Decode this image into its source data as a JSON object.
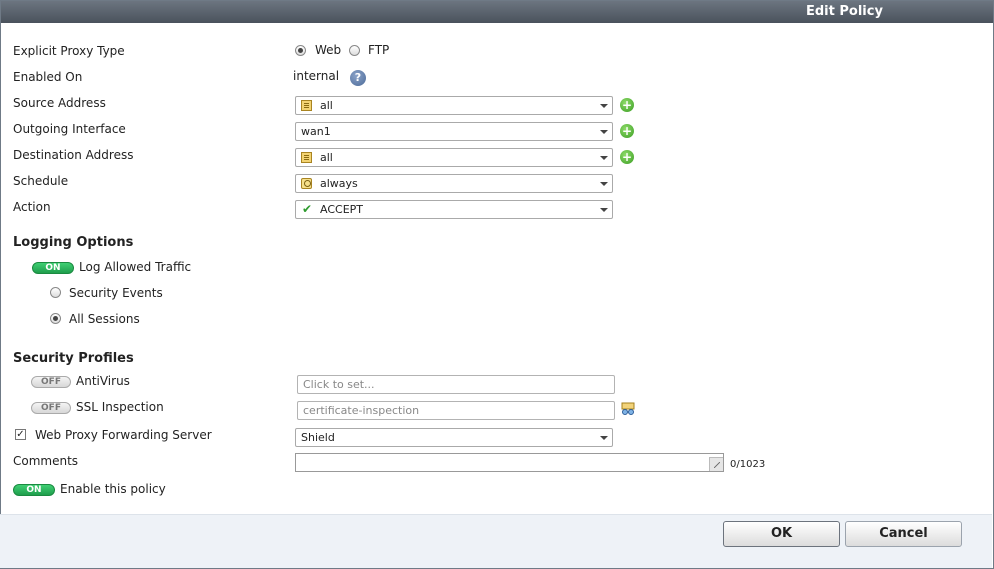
{
  "window": {
    "title": "Edit Policy"
  },
  "form": {
    "proxy_type": {
      "label": "Explicit Proxy Type",
      "options": [
        "Web",
        "FTP"
      ],
      "selected": "Web"
    },
    "enabled_on": {
      "label": "Enabled On",
      "value": "internal",
      "help_icon": "?"
    },
    "source_address": {
      "label": "Source Address",
      "value": "all"
    },
    "outgoing_interface": {
      "label": "Outgoing Interface",
      "value": "wan1"
    },
    "destination_address": {
      "label": "Destination Address",
      "value": "all"
    },
    "schedule": {
      "label": "Schedule",
      "value": "always"
    },
    "action": {
      "label": "Action",
      "value": "ACCEPT"
    }
  },
  "logging": {
    "heading": "Logging Options",
    "toggle": {
      "state": "ON",
      "label": "Log Allowed Traffic"
    },
    "options": [
      "Security Events",
      "All Sessions"
    ],
    "selected": "All Sessions"
  },
  "security_profiles": {
    "heading": "Security Profiles",
    "antivirus": {
      "state": "OFF",
      "label": "AntiVirus",
      "placeholder": "Click to set..."
    },
    "ssl_inspection": {
      "state": "OFF",
      "label": "SSL Inspection",
      "value": "certificate-inspection"
    },
    "web_proxy_forwarding": {
      "checked": true,
      "label": "Web Proxy Forwarding Server",
      "value": "Shield"
    }
  },
  "comments": {
    "label": "Comments",
    "counter": "0/1023"
  },
  "enable_policy": {
    "state": "ON",
    "label": "Enable this policy"
  },
  "footer": {
    "ok_label": "OK",
    "cancel_label": "Cancel"
  }
}
